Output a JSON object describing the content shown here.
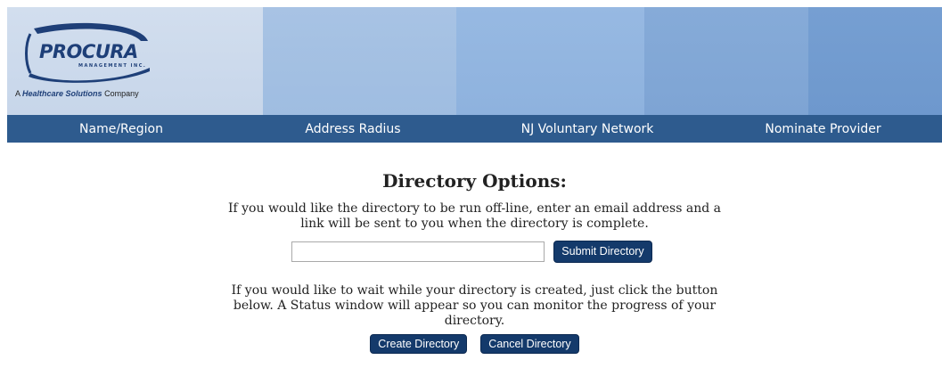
{
  "brand": {
    "name": "PROCURA",
    "sub": "MANAGEMENT INC.",
    "tagline_prefix": "A",
    "tagline_bold": "Healthcare Solutions",
    "tagline_suffix": "Company"
  },
  "nav": {
    "items": [
      {
        "label": "Name/Region"
      },
      {
        "label": "Address Radius"
      },
      {
        "label": "NJ Voluntary Network"
      },
      {
        "label": "Nominate Provider"
      }
    ]
  },
  "main": {
    "title": "Directory Options:",
    "offline_text": "If you would like the directory to be run off-line, enter an email address and a link will be sent to you when the directory is complete.",
    "email_value": "",
    "submit_label": "Submit Directory",
    "wait_text": "If you would like to wait while your directory is created, just click the button below. A Status window will appear so you can monitor the progress of your directory.",
    "create_label": "Create Directory",
    "cancel_label": "Cancel Directory"
  },
  "colors": {
    "navbar": "#2e5b8e",
    "button": "#143a6b",
    "brand": "#1e3f78"
  }
}
